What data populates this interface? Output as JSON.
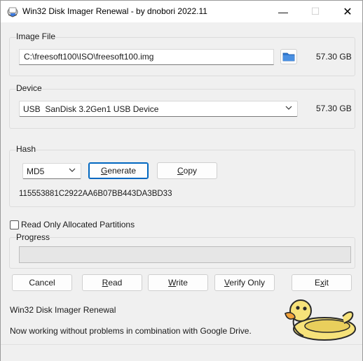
{
  "window": {
    "title": "Win32 Disk Imager Renewal - by dnobori 2022.11",
    "controls": {
      "minimize": "—",
      "maximize": "☐",
      "close": "✕"
    }
  },
  "image_file": {
    "label": "Image File",
    "path": "C:\\freesoft100\\ISO\\freesoft100.img",
    "size": "57.30 GB",
    "browse_icon": "folder-icon"
  },
  "device": {
    "label": "Device",
    "selected": "USB  SanDisk 3.2Gen1 USB Device",
    "size": "57.30 GB"
  },
  "hash": {
    "label": "Hash",
    "algorithm": "MD5",
    "generate_label": {
      "pre": "",
      "key": "G",
      "post": "enerate"
    },
    "copy_label": {
      "pre": "",
      "key": "C",
      "post": "opy"
    },
    "value": "115553881C2922AA6B07BB443DA3BD33"
  },
  "options": {
    "read_only_allocated": "Read Only Allocated Partitions",
    "read_only_checked": false
  },
  "progress": {
    "label": "Progress",
    "value": 0
  },
  "actions": {
    "cancel": "Cancel",
    "read": {
      "pre": "",
      "key": "R",
      "post": "ead"
    },
    "write": {
      "pre": "",
      "key": "W",
      "post": "rite"
    },
    "verify": {
      "pre": "",
      "key": "V",
      "post": "erify Only"
    },
    "exit": {
      "pre": "E",
      "key": "x",
      "post": "it"
    }
  },
  "footer": {
    "app_name": "Win32 Disk Imager Renewal",
    "message": "Now working without problems in combination with Google Drive."
  },
  "colors": {
    "accent": "#0067c0",
    "folder_blue": "#2f78d0",
    "duck_yellow": "#f6e27a"
  }
}
